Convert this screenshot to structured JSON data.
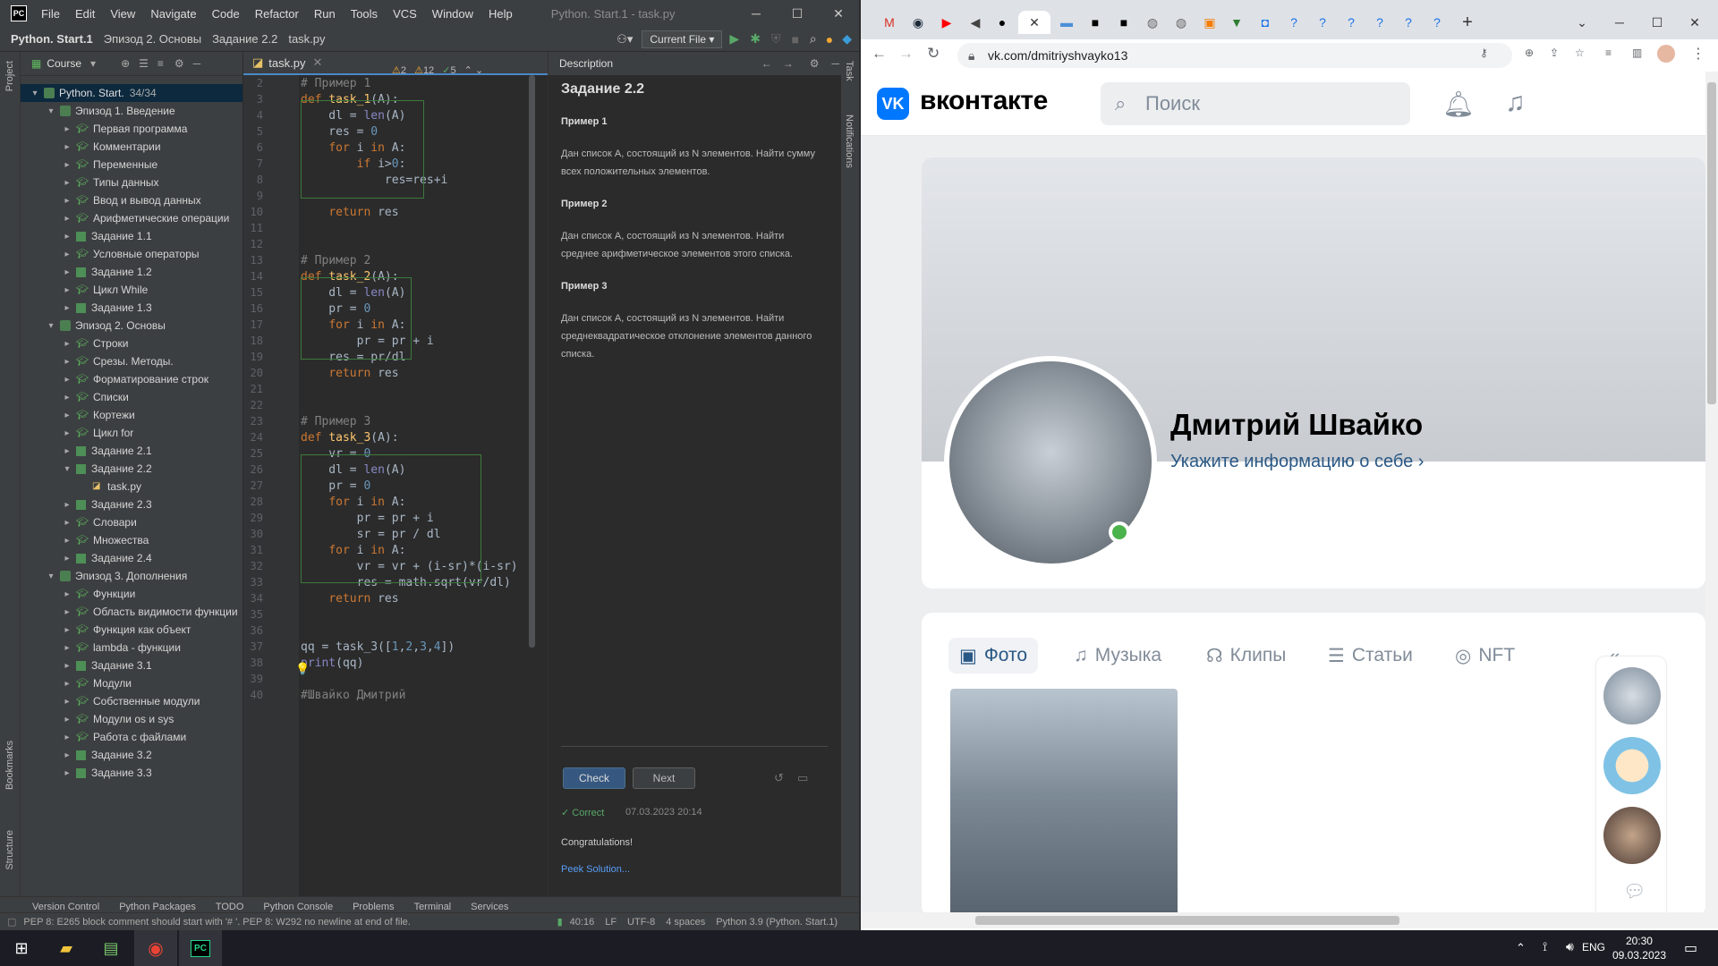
{
  "ide": {
    "title_text": "Python. Start.1 - task.py",
    "menu": [
      "File",
      "Edit",
      "View",
      "Navigate",
      "Code",
      "Refactor",
      "Run",
      "Tools",
      "VCS",
      "Window",
      "Help"
    ],
    "breadcrumb": [
      "Python. Start.1",
      "Эпизод 2. Основы",
      "Задание 2.2",
      "task.py"
    ],
    "run_config": "Current File",
    "project_label": "Course",
    "tree": [
      {
        "label": "Python. Start.",
        "count": "34/34",
        "level": 0,
        "type": "root",
        "open": true
      },
      {
        "label": "Эпизод 1. Введение",
        "level": 1,
        "type": "episode",
        "open": true
      },
      {
        "label": "Первая программа",
        "level": 2,
        "type": "cap"
      },
      {
        "label": "Комментарии",
        "level": 2,
        "type": "cap"
      },
      {
        "label": "Переменные",
        "level": 2,
        "type": "cap"
      },
      {
        "label": "Типы данных",
        "level": 2,
        "type": "cap"
      },
      {
        "label": "Ввод и вывод данных",
        "level": 2,
        "type": "cap"
      },
      {
        "label": "Арифметические операции",
        "level": 2,
        "type": "cap"
      },
      {
        "label": "Задание 1.1",
        "level": 2,
        "type": "task"
      },
      {
        "label": "Условные операторы",
        "level": 2,
        "type": "cap"
      },
      {
        "label": "Задание 1.2",
        "level": 2,
        "type": "task"
      },
      {
        "label": "Цикл While",
        "level": 2,
        "type": "cap"
      },
      {
        "label": "Задание 1.3",
        "level": 2,
        "type": "task"
      },
      {
        "label": "Эпизод 2. Основы",
        "level": 1,
        "type": "episode",
        "open": true
      },
      {
        "label": "Строки",
        "level": 2,
        "type": "cap"
      },
      {
        "label": "Срезы. Методы.",
        "level": 2,
        "type": "cap"
      },
      {
        "label": "Форматирование строк",
        "level": 2,
        "type": "cap"
      },
      {
        "label": "Списки",
        "level": 2,
        "type": "cap"
      },
      {
        "label": "Кортежи",
        "level": 2,
        "type": "cap"
      },
      {
        "label": "Цикл for",
        "level": 2,
        "type": "cap"
      },
      {
        "label": "Задание 2.1",
        "level": 2,
        "type": "task"
      },
      {
        "label": "Задание 2.2",
        "level": 2,
        "type": "task",
        "open": true
      },
      {
        "label": "task.py",
        "level": 3,
        "type": "py"
      },
      {
        "label": "Задание 2.3",
        "level": 2,
        "type": "task"
      },
      {
        "label": "Словари",
        "level": 2,
        "type": "cap"
      },
      {
        "label": "Множества",
        "level": 2,
        "type": "cap"
      },
      {
        "label": "Задание 2.4",
        "level": 2,
        "type": "task"
      },
      {
        "label": "Эпизод 3. Дополнения",
        "level": 1,
        "type": "episode",
        "open": true
      },
      {
        "label": "Функции",
        "level": 2,
        "type": "cap"
      },
      {
        "label": "Область видимости функции",
        "level": 2,
        "type": "cap"
      },
      {
        "label": "Функция как объект",
        "level": 2,
        "type": "cap"
      },
      {
        "label": "lambda - функции",
        "level": 2,
        "type": "cap"
      },
      {
        "label": "Задание 3.1",
        "level": 2,
        "type": "task"
      },
      {
        "label": "Модули",
        "level": 2,
        "type": "cap"
      },
      {
        "label": "Собственные модули",
        "level": 2,
        "type": "cap"
      },
      {
        "label": "Модули os и sys",
        "level": 2,
        "type": "cap"
      },
      {
        "label": "Работа с файлами",
        "level": 2,
        "type": "cap"
      },
      {
        "label": "Задание 3.2",
        "level": 2,
        "type": "task"
      },
      {
        "label": "Задание 3.3",
        "level": 2,
        "type": "task"
      }
    ],
    "editor_tab": "task.py",
    "inspections": {
      "warnings": "2",
      "weak": "12",
      "ok": "5"
    },
    "code": [
      {
        "n": "2",
        "html": "<span class='cm'># Пример 1</span>"
      },
      {
        "n": "3",
        "html": "<span class='kw'>def</span> <span class='fn'>task_1</span>(A):"
      },
      {
        "n": "4",
        "html": "    dl = <span class='bi'>len</span>(A)"
      },
      {
        "n": "5",
        "html": "    res = <span class='num'>0</span>"
      },
      {
        "n": "6",
        "html": "    <span class='kw'>for</span> i <span class='kw'>in</span> A:"
      },
      {
        "n": "7",
        "html": "        <span class='kw'>if</span> i&gt;<span class='num'>0</span>:"
      },
      {
        "n": "8",
        "html": "            res=res+i"
      },
      {
        "n": "9",
        "html": ""
      },
      {
        "n": "10",
        "html": "    <span class='kw'>return</span> res"
      },
      {
        "n": "11",
        "html": ""
      },
      {
        "n": "12",
        "html": ""
      },
      {
        "n": "13",
        "html": "<span class='cm'># Пример 2</span>"
      },
      {
        "n": "14",
        "html": "<span class='kw'>def</span> <span class='fn'>task_2</span>(A):"
      },
      {
        "n": "15",
        "html": "    dl = <span class='bi'>len</span>(A)"
      },
      {
        "n": "16",
        "html": "    pr = <span class='num'>0</span>"
      },
      {
        "n": "17",
        "html": "    <span class='kw'>for</span> i <span class='kw'>in</span> A:"
      },
      {
        "n": "18",
        "html": "        pr = pr + i"
      },
      {
        "n": "19",
        "html": "    res = pr/dl"
      },
      {
        "n": "20",
        "html": "    <span class='kw'>return</span> res"
      },
      {
        "n": "21",
        "html": ""
      },
      {
        "n": "22",
        "html": ""
      },
      {
        "n": "23",
        "html": "<span class='cm'># Пример 3</span>"
      },
      {
        "n": "24",
        "html": "<span class='kw'>def</span> <span class='fn'>task_3</span>(A):"
      },
      {
        "n": "25",
        "html": "    vr = <span class='num'>0</span>"
      },
      {
        "n": "26",
        "html": "    dl = <span class='bi'>len</span>(A)"
      },
      {
        "n": "27",
        "html": "    pr = <span class='num'>0</span>"
      },
      {
        "n": "28",
        "html": "    <span class='kw'>for</span> i <span class='kw'>in</span> A:"
      },
      {
        "n": "29",
        "html": "        pr = pr + i"
      },
      {
        "n": "30",
        "html": "        sr = pr / dl"
      },
      {
        "n": "31",
        "html": "    <span class='kw'>for</span> i <span class='kw'>in</span> A:"
      },
      {
        "n": "32",
        "html": "        vr = vr + (i-sr)*(i-sr)"
      },
      {
        "n": "33",
        "html": "        res = math.sqrt(vr/dl)"
      },
      {
        "n": "34",
        "html": "    <span class='kw'>return</span> res"
      },
      {
        "n": "35",
        "html": ""
      },
      {
        "n": "36",
        "html": ""
      },
      {
        "n": "37",
        "html": "qq = task_3([<span class='num'>1</span>,<span class='num'>2</span>,<span class='num'>3</span>,<span class='num'>4</span>])"
      },
      {
        "n": "38",
        "html": "<span class='bi'>print</span>(qq)"
      },
      {
        "n": "39",
        "html": ""
      },
      {
        "n": "40",
        "html": "<span class='cm'>#Швайко Дмитрий</span>"
      }
    ],
    "description": {
      "header": "Description",
      "title": "Задание 2.2",
      "ex1_title": "Пример 1",
      "ex1_text": "Дан список A, состоящий из N элементов. Найти сумму всех положительных элементов.",
      "ex2_title": "Пример 2",
      "ex2_text": "Дан список A, состоящий из N элементов. Найти среднее арифметическое элементов этого списка.",
      "ex3_title": "Пример 3",
      "ex3_text": "Дан список A, состоящий из N элементов. Найти среднеквадратическое отклонение элементов данного списка.",
      "check": "Check",
      "next": "Next",
      "correct": "Correct",
      "correct_time": "07.03.2023 20:14",
      "congrats": "Congratulations!",
      "peek": "Peek Solution..."
    },
    "bottom_tabs": [
      "Version Control",
      "Python Packages",
      "TODO",
      "Python Console",
      "Problems",
      "Terminal",
      "Services"
    ],
    "status_msg": "PEP 8: E265 block comment should start with '# '. PEP 8: W292 no newline at end of file.",
    "status_right": [
      "40:16",
      "LF",
      "UTF-8",
      "4 spaces",
      "Python 3.9 (Python. Start.1)"
    ],
    "left_strip": [
      "Project",
      "Bookmarks",
      "Structure"
    ],
    "right_strip": [
      "Task",
      "Notifications"
    ]
  },
  "browser": {
    "url": "vk.com/dmitriyshvayko13",
    "new_tab": "+",
    "site": {
      "logo_text": "вконтакте",
      "search_placeholder": "Поиск",
      "profile_name": "Дмитрий Швайко",
      "profile_info": "Укажите информацию о себе",
      "tabs": [
        "Фото",
        "Музыка",
        "Клипы",
        "Статьи",
        "NFT"
      ]
    }
  },
  "taskbar": {
    "lang": "ENG",
    "time": "20:30",
    "date": "09.03.2023"
  },
  "colors": {
    "vk_blue": "#0077ff",
    "ide_bg": "#2b2b2b",
    "online_green": "#4bb34b"
  }
}
